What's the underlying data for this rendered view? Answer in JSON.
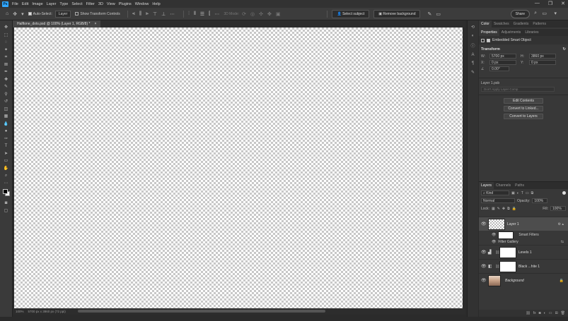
{
  "app": {
    "logo": "Ps"
  },
  "menu": [
    "File",
    "Edit",
    "Image",
    "Layer",
    "Type",
    "Select",
    "Filter",
    "3D",
    "View",
    "Plugins",
    "Window",
    "Help"
  ],
  "window_controls": {
    "minimize": "—",
    "maximize": "❐",
    "close": "✕"
  },
  "options": {
    "auto_select_label": "Auto-Select:",
    "auto_select_value": "Layer",
    "show_transform_label": "Show Transform Controls",
    "mode_3d_label": "3D Mode:",
    "select_subject": "Select subject",
    "remove_background": "Remove background",
    "share": "Share"
  },
  "document": {
    "tab_title": "Halftone_dots.psd @ 100% (Layer 1, RGB/8) *",
    "close": "×",
    "zoom": "100%",
    "doc_info": "5700 px x 3860 px (72 ppi)"
  },
  "right_tabs_top": [
    "Color",
    "Swatches",
    "Gradients",
    "Patterns"
  ],
  "right_tabs_mid": [
    "Properties",
    "Adjustments",
    "Libraries"
  ],
  "properties": {
    "type": "Embedded Smart Object",
    "transform_title": "Transform",
    "w_label": "W:",
    "w_value": "5700 px",
    "h_label": "H:",
    "h_value": "3860 px",
    "x_label": "X:",
    "x_value": "0 px",
    "y_label": "Y:",
    "y_value": "0 px",
    "angle_value": "0.00°",
    "file_name": "Layer 1.psb",
    "layer_comp": "Don't Apply Layer Comp",
    "edit_contents": "Edit Contents",
    "convert_linked": "Convert to Linked...",
    "convert_layers": "Convert to Layers"
  },
  "layers_tabs": [
    "Layers",
    "Channels",
    "Paths"
  ],
  "layers_panel": {
    "kind": "Kind",
    "blend": "Normal",
    "opacity_label": "Opacity:",
    "opacity_value": "100%",
    "lock_label": "Lock:",
    "fill_label": "Fill:",
    "fill_value": "100%",
    "layers": [
      {
        "name": "Layer 1"
      },
      {
        "name": "Smart Filters"
      },
      {
        "name": "Filter Gallery"
      },
      {
        "name": "Levels 1"
      },
      {
        "name": "Black ...hite 1"
      },
      {
        "name": "Background"
      }
    ]
  }
}
